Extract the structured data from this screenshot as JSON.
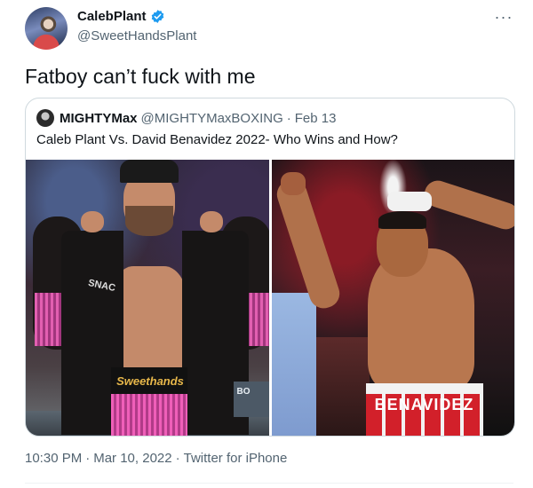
{
  "author": {
    "display_name": "CalebPlant",
    "handle": "@SweetHandsPlant",
    "verified": true,
    "avatar_icon": "profile-avatar"
  },
  "tweet": {
    "text": "Fatboy can’t fuck with me",
    "time": "10:30 PM",
    "date": "Mar 10, 2022",
    "source": "Twitter for iPhone",
    "separator": "·"
  },
  "quoted": {
    "display_name": "MIGHTYMax",
    "handle": "@MIGHTYMaxBOXING",
    "date": "Feb 13",
    "separator": "·",
    "text": "Caleb Plant Vs. David Benavidez 2022- Who Wins and How?",
    "images": [
      {
        "robe_text": "SNAC",
        "trunks_text": "Sweethands",
        "sign_text": "BO"
      },
      {
        "trunks_text": "BENAVIDEZ"
      }
    ]
  },
  "colors": {
    "text": "#0f1419",
    "secondary": "#536471",
    "verified": "#1d9bf0",
    "border": "#cfd9de"
  },
  "icons": {
    "more": "more-horizontal-icon",
    "verified": "verified-badge-icon"
  }
}
